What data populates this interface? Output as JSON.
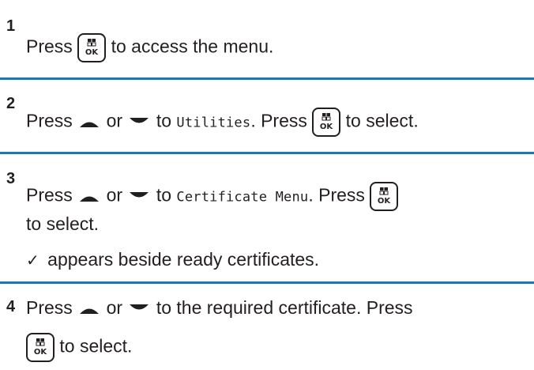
{
  "steps": [
    {
      "number": "1",
      "line1_before": "Press",
      "line1_after": "to access the menu."
    },
    {
      "number": "2",
      "part1": "Press",
      "part2": "or",
      "part3": "to",
      "menu_item": "Utilities",
      "part4": ". Press",
      "part5": "to select."
    },
    {
      "number": "3",
      "part1": "Press",
      "part2": "or",
      "part3": "to",
      "menu_item": "Certificate Menu",
      "part4": ". Press",
      "line2": "to select.",
      "note": "appears beside ready certificates.",
      "note_icon": "checkmark-icon"
    },
    {
      "number": "4",
      "part1": "Press",
      "part2": "or",
      "part3": "to the required certificate. Press",
      "line2": "to select."
    }
  ],
  "ok_button": {
    "label": "OK",
    "icon": "menu-ok-button-icon"
  },
  "icons": {
    "up": "up-arrow-icon",
    "down": "down-arrow-icon",
    "check": "✓"
  },
  "colors": {
    "text": "#231f20",
    "divider": "#1a79b4"
  }
}
